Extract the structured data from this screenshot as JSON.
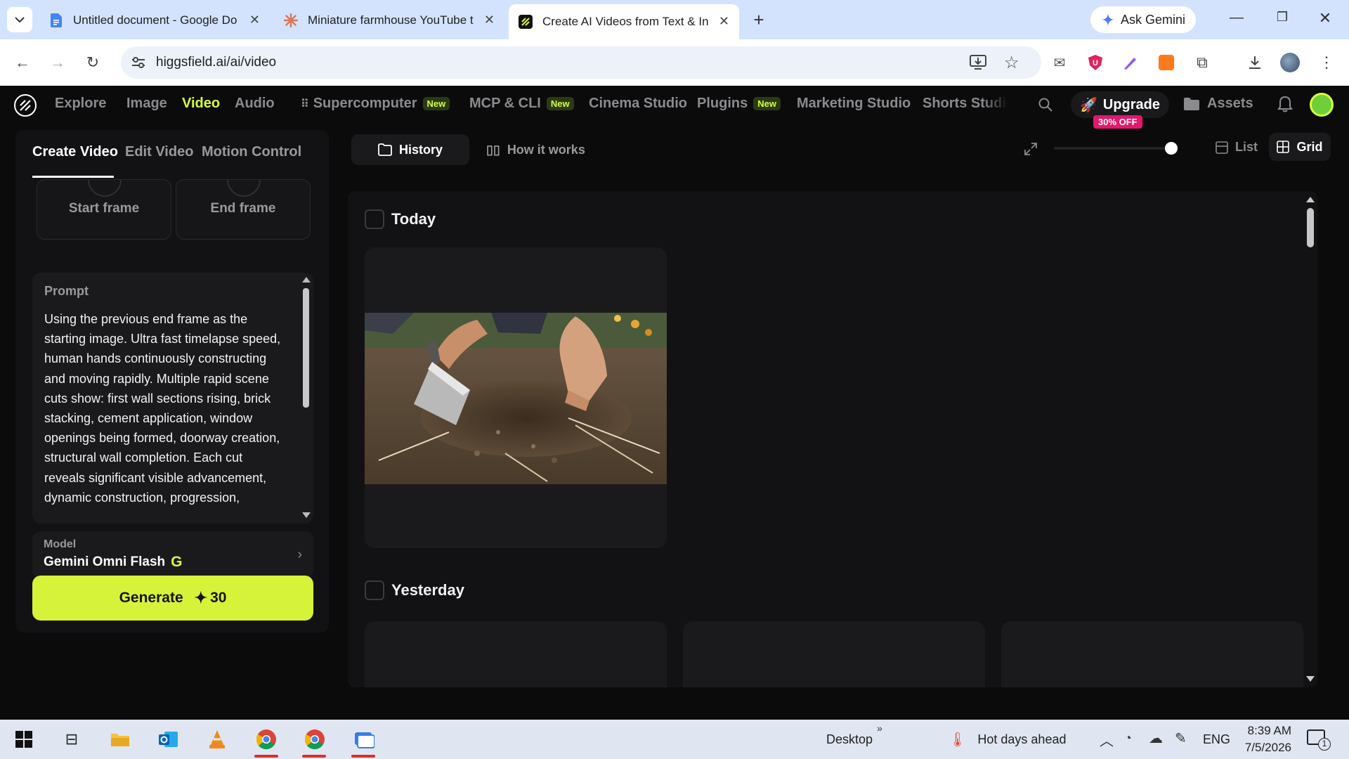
{
  "browser": {
    "tabs": [
      {
        "title": "Untitled document - Google Do",
        "icon": "docs-icon"
      },
      {
        "title": "Miniature farmhouse YouTube t",
        "icon": "claude-icon"
      },
      {
        "title": "Create AI Videos from Text & In",
        "icon": "higgsfield-icon",
        "active": true
      }
    ],
    "ask_gemini": "Ask Gemini",
    "url": "higgsfield.ai/ai/video"
  },
  "site_nav": {
    "items": [
      "Explore",
      "Image",
      "Video",
      "Audio",
      "Supercomputer",
      "MCP & CLI",
      "Cinema Studio",
      "Plugins",
      "Marketing Studio",
      "Shorts Studio"
    ],
    "active": "Video",
    "new_badge": "New",
    "upgrade": "Upgrade",
    "discount": "30% OFF",
    "assets": "Assets",
    "accent": "#d6ff3a"
  },
  "left_panel": {
    "tabs": [
      "Create Video",
      "Edit Video",
      "Motion Control"
    ],
    "start_frame": "Start frame",
    "end_frame": "End frame",
    "prompt_label": "Prompt",
    "prompt_text": "Using the previous end frame as the starting image. Ultra fast timelapse speed, human hands continuously constructing and moving rapidly. Multiple rapid scene cuts show: first wall sections rising, brick stacking, cement application, window openings being formed, doorway creation, structural wall completion. Each cut reveals significant visible advancement, dynamic construction, progression,",
    "model_label": "Model",
    "model_name": "Gemini Omni Flash",
    "model_badge": "G",
    "generate_label": "Generate",
    "generate_cost": "30"
  },
  "main_header": {
    "history": "History",
    "how_it_works": "How it works",
    "list": "List",
    "grid": "Grid"
  },
  "history": {
    "today": "Today",
    "yesterday": "Yesterday"
  },
  "taskbar": {
    "desktop": "Desktop",
    "weather": "Hot days ahead",
    "lang": "ENG",
    "time": "8:39 AM",
    "date": "7/5/2026",
    "notifications": "1"
  }
}
